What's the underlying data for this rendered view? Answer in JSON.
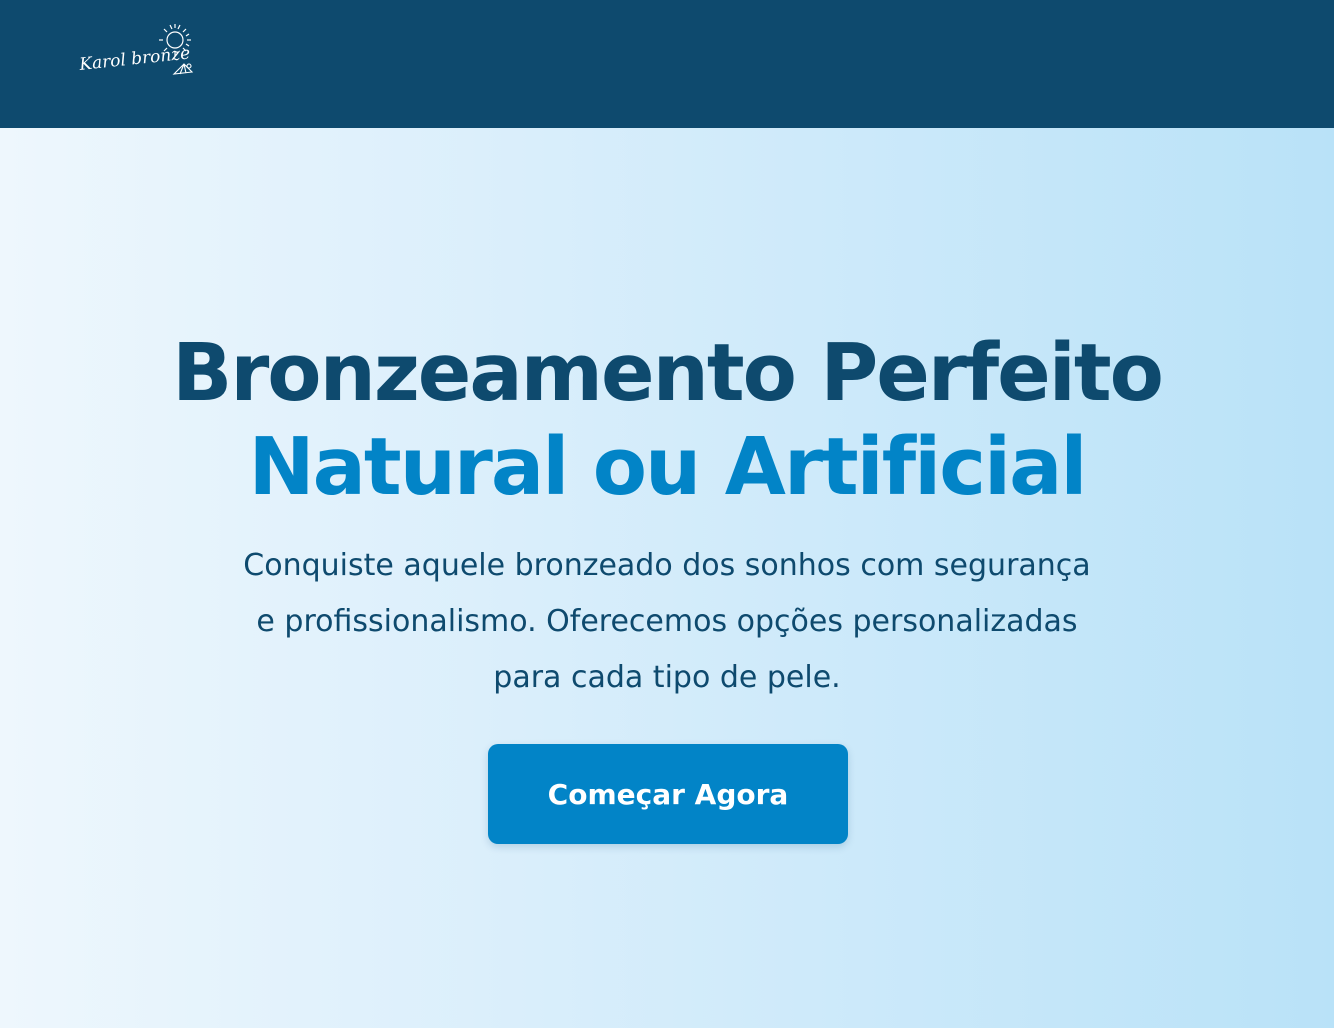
{
  "header": {
    "logo_text": "Karol bronze",
    "background_color": "#0e4a6e"
  },
  "hero": {
    "title_line1": "Bronzeamento Perfeito",
    "title_line2": "Natural ou Artificial",
    "subtitle": "Conquiste aquele bronzeado dos sonhos com segurança e profissionalismo. Oferecemos opções personalizadas para cada tipo de pele.",
    "cta_label": "Começar Agora"
  },
  "colors": {
    "primary_dark": "#0e4a6e",
    "accent": "#0284c7",
    "background_start": "#eef7fd",
    "background_end": "#b9e2f8"
  },
  "icons": [
    "sun-icon",
    "shell-icon"
  ]
}
